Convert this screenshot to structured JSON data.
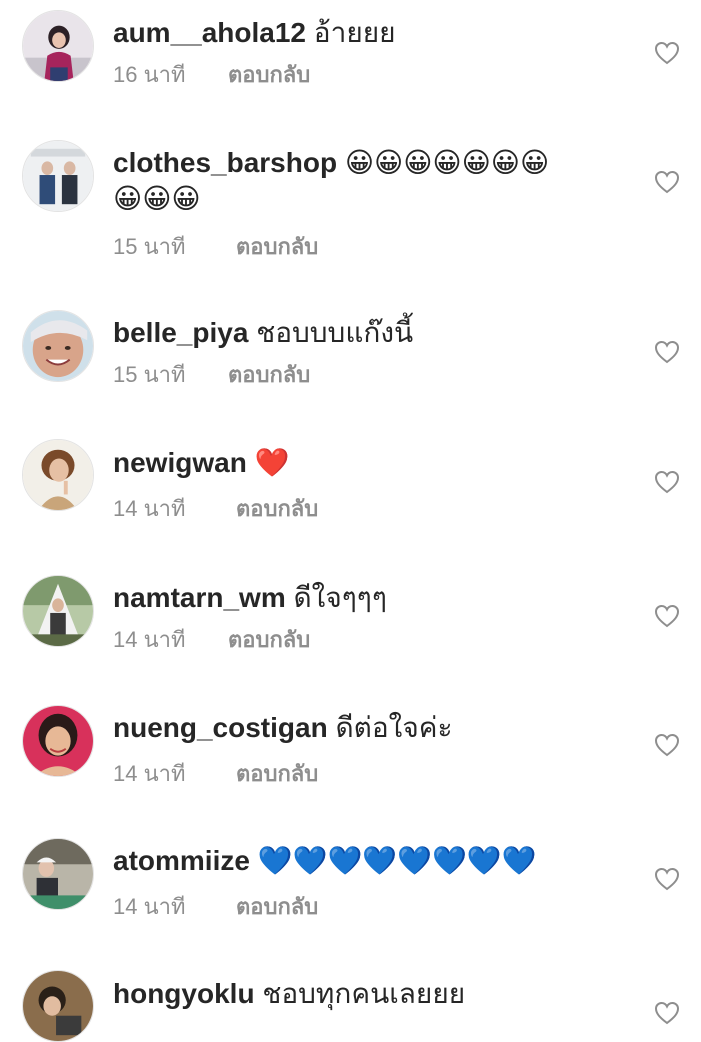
{
  "comments": [
    {
      "username": "aum__ahola12",
      "text": "อ้ายยย",
      "emoji": "",
      "time": "16 นาที",
      "reply": "ตอบกลับ"
    },
    {
      "username": "clothes_barshop",
      "text": "",
      "emoji_line1": "😀😀😀😀😀😀😀",
      "emoji_line2": "😀😀😀",
      "time": "15 นาที",
      "reply": "ตอบกลับ"
    },
    {
      "username": "belle_piya",
      "text": "ชอบบบแก๊งนี้",
      "time": "15 นาที",
      "reply": "ตอบกลับ"
    },
    {
      "username": "newigwan",
      "text": "",
      "emoji": "❤️",
      "time": "14 นาที",
      "reply": "ตอบกลับ"
    },
    {
      "username": "namtarn_wm",
      "text": "ดีใจๆๆๆ",
      "time": "14 นาที",
      "reply": "ตอบกลับ"
    },
    {
      "username": "nueng_costigan",
      "text": "ดีต่อใจค่ะ",
      "time": "14 นาที",
      "reply": "ตอบกลับ"
    },
    {
      "username": "atommiize",
      "text": "",
      "emoji": "💙💙💙💙💙💙💙💙",
      "time": "14 นาที",
      "reply": "ตอบกลับ"
    },
    {
      "username": "hongyoklu",
      "text": "ชอบทุกคนเลยยย",
      "time": "",
      "reply": ""
    }
  ],
  "icons": {
    "like": "heart-outline-icon"
  },
  "colors": {
    "text": "#262626",
    "meta": "#8e8e8e",
    "heart_stroke": "#8e8e8e",
    "blue_heart": "#1e9df2",
    "red_heart": "#e8303c",
    "emoji_face": "#f7c525"
  }
}
